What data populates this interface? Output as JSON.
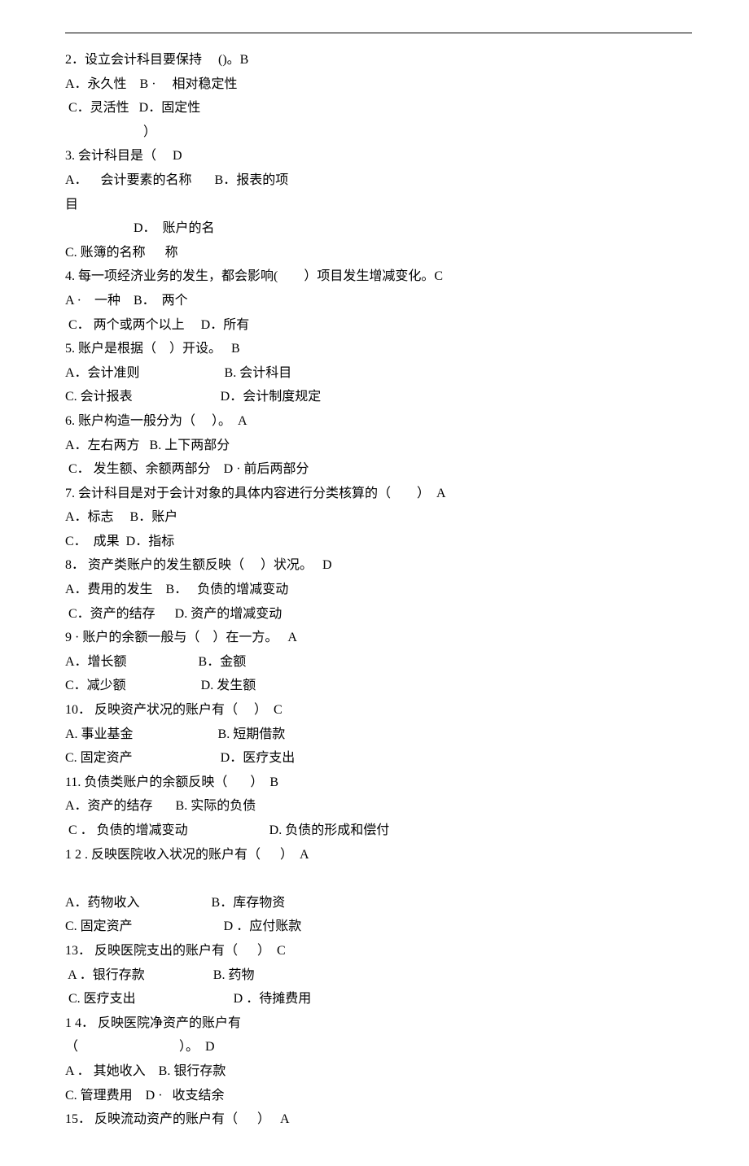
{
  "lines": [
    "2．设立会计科目要保持     ()。B",
    "A．永久性    B ·     相对稳定性",
    " C．灵活性   D．固定性",
    "                        ）",
    "3. 会计科目是（     D",
    "A．    会计要素的名称       B．报表的项",
    "目",
    "                     D．  账户的名",
    "C. 账簿的名称      称",
    "4. 每一项经济业务的发生，都会影响(        ）项目发生增减变化。C",
    "A ·    一种    B．  两个",
    " C． 两个或两个以上     D．所有",
    "5. 账户是根据（    ）开设。   B",
    "A．会计准则                          B. 会计科目",
    "C. 会计报表                           D．会计制度规定",
    "6. 账户构造一般分为（     ）。  A",
    "A．左右两方   B. 上下两部分",
    " C． 发生额、余额两部分    D · 前后两部分",
    "7. 会计科目是对于会计对象的具体内容进行分类核算的（        ）  A",
    "A．标志     B．账户",
    "C．  成果  D．指标",
    "8． 资产类账户的发生额反映（     ）状况。   D",
    "A．费用的发生    B．   负债的增减变动",
    " C．资产的结存      D. 资产的增减变动",
    "9 · 账户的余额一般与（    ）在一方。   A",
    "A．增长额                      B．金额",
    "C．减少额                       D. 发生额",
    "10． 反映资产状况的账户有（     ）  C",
    "A. 事业基金                          B. 短期借款",
    "C. 固定资产                           D．医疗支出",
    "11. 负债类账户的余额反映（       ）  B",
    "A．资产的结存       B. 实际的负债",
    " C ． 负债的增减变动                         D. 负债的形成和偿付",
    "1 2 . 反映医院收入状况的账户有（      ）  A",
    "",
    "A．药物收入                      B．库存物资",
    "C. 固定资产                            D ．应付账款",
    "13． 反映医院支出的账户有（      ）  C",
    " A ．银行存款                     B. 药物",
    " C. 医疗支出                              D ．待摊费用",
    "1 4． 反映医院净资产的账户有",
    "（                               ）。  D",
    "A ． 其她收入    B. 银行存款",
    "C. 管理费用    D ·   收支结余",
    "15． 反映流动资产的账户有（      ）   A"
  ]
}
